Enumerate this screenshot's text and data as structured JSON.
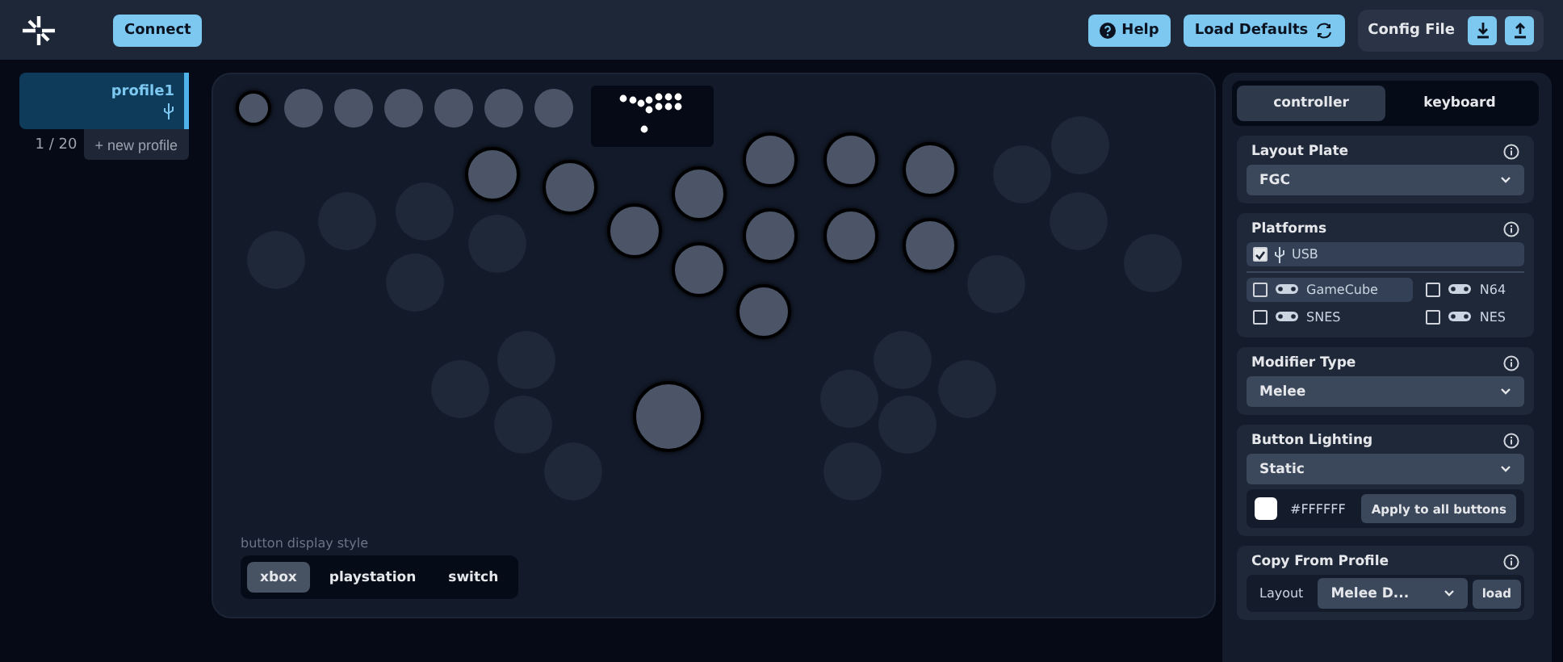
{
  "toolbar": {
    "connect": "Connect",
    "help": "Help",
    "load_defaults": "Load Defaults",
    "config_file": "Config File"
  },
  "profiles": [
    {
      "name": "profile1",
      "selected": true
    }
  ],
  "profile_count": "1 / 20",
  "new_profile": "+ new profile",
  "controller_buttons": [
    {
      "active": true
    },
    {
      "active": false
    },
    {
      "active": false
    },
    {
      "active": false
    },
    {
      "active": false
    },
    {
      "active": false
    },
    {
      "active": false
    },
    {
      "active": true
    },
    {
      "active": true
    },
    {
      "active": true
    },
    {
      "active": true
    },
    {
      "active": true
    },
    {
      "active": true
    },
    {
      "active": true
    },
    {
      "active": true
    },
    {
      "active": true
    },
    {
      "active": true
    },
    {
      "active": true
    },
    {
      "active": true
    },
    {
      "active": true
    },
    {
      "active": false
    },
    {
      "active": false
    },
    {
      "active": false
    },
    {
      "active": false
    },
    {
      "active": false
    },
    {
      "active": false
    },
    {
      "active": false
    },
    {
      "active": false
    },
    {
      "active": false
    },
    {
      "active": false
    },
    {
      "active": false
    },
    {
      "active": false
    },
    {
      "active": false
    },
    {
      "active": false
    },
    {
      "active": false
    },
    {
      "active": false
    },
    {
      "active": false
    },
    {
      "active": false
    },
    {
      "active": false
    }
  ],
  "display_style": {
    "label": "button display style",
    "options": [
      {
        "label": "xbox",
        "selected": true
      },
      {
        "label": "playstation",
        "selected": false
      },
      {
        "label": "switch",
        "selected": false
      }
    ]
  },
  "mode_tabs": [
    {
      "label": "controller",
      "selected": true
    },
    {
      "label": "keyboard",
      "selected": false
    }
  ],
  "layout_plate": {
    "title": "Layout Plate",
    "value": "FGC"
  },
  "platforms": {
    "title": "Platforms",
    "items": [
      {
        "label": "USB",
        "checked": true
      },
      {
        "label": "GameCube",
        "checked": false
      },
      {
        "label": "N64",
        "checked": false
      },
      {
        "label": "SNES",
        "checked": false
      },
      {
        "label": "NES",
        "checked": false
      }
    ]
  },
  "modifier_type": {
    "title": "Modifier Type",
    "value": "Melee"
  },
  "button_lighting": {
    "title": "Button Lighting",
    "value": "Static",
    "color": "#ffffff",
    "color_text": "#FFFFFF",
    "apply": "Apply to all buttons"
  },
  "copy_from_profile": {
    "title": "Copy From Profile",
    "label": "Layout",
    "value": "Melee D...",
    "load": "load"
  }
}
